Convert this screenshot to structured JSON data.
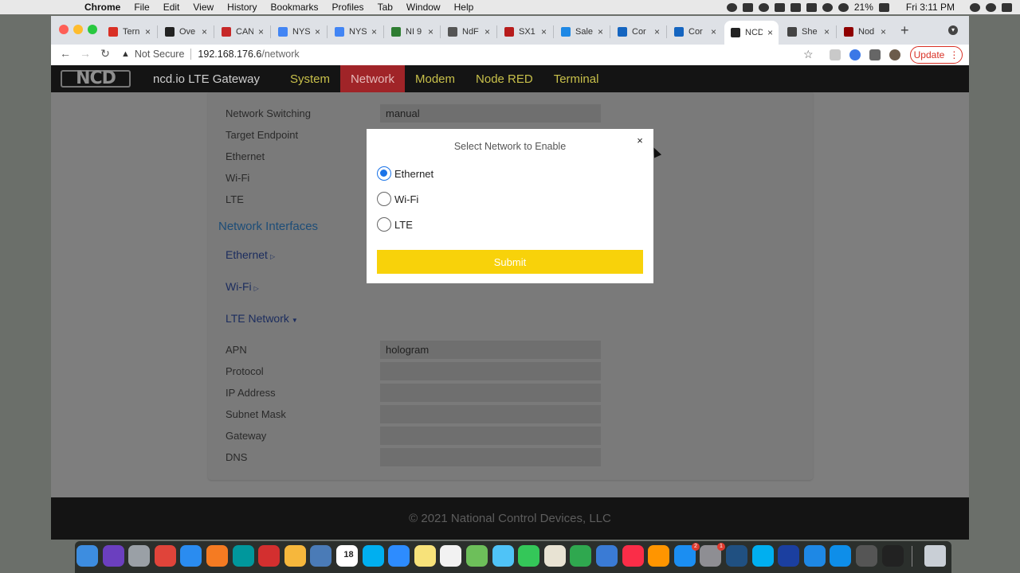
{
  "menubar": {
    "app": "Chrome",
    "items": [
      "File",
      "Edit",
      "View",
      "History",
      "Bookmarks",
      "Profiles",
      "Tab",
      "Window",
      "Help"
    ],
    "battery": "21%",
    "clock": "Fri 3:11 PM"
  },
  "tabs": [
    {
      "label": "Tern",
      "favicon": "gmail-icon",
      "color": "#d93025"
    },
    {
      "label": "Ove",
      "favicon": "link-icon",
      "color": "#222222"
    },
    {
      "label": "CAN",
      "favicon": "g-icon",
      "color": "#c62828"
    },
    {
      "label": "NYS",
      "favicon": "google-icon",
      "color": "#4285f4"
    },
    {
      "label": "NYS",
      "favicon": "google-icon",
      "color": "#4285f4"
    },
    {
      "label": "NI 9",
      "favicon": "ni-icon",
      "color": "#2e7d32"
    },
    {
      "label": "NdF",
      "favicon": "globe-icon",
      "color": "#555555"
    },
    {
      "label": "SX1",
      "favicon": "s-icon",
      "color": "#b71c1c"
    },
    {
      "label": "Sale",
      "favicon": "cloud-icon",
      "color": "#1e88e5"
    },
    {
      "label": "Cor",
      "favicon": "bing-icon",
      "color": "#1565c0"
    },
    {
      "label": "Cor",
      "favicon": "bing-icon",
      "color": "#1565c0"
    },
    {
      "label": "NCD",
      "favicon": "link-icon",
      "color": "#222222",
      "active": true
    },
    {
      "label": "She",
      "favicon": "doc-icon",
      "color": "#444444"
    },
    {
      "label": "Nod",
      "favicon": "node-red-icon",
      "color": "#8f0000"
    }
  ],
  "toolbar": {
    "security": "Not Secure",
    "host": "192.168.176.6",
    "path": "/network",
    "update_label": "Update"
  },
  "site": {
    "logo": "NCD",
    "title": "ncd.io LTE Gateway",
    "nav": [
      {
        "label": "System",
        "active": false
      },
      {
        "label": "Network",
        "active": true
      },
      {
        "label": "Modem",
        "active": false
      },
      {
        "label": "Node RED",
        "active": false
      },
      {
        "label": "Terminal",
        "active": false
      }
    ],
    "footer": "© 2021 National Control Devices, LLC"
  },
  "settings": {
    "network_switching": {
      "label": "Network Switching",
      "value": "manual"
    },
    "target_endpoint": "Target Endpoint",
    "ethernet": "Ethernet",
    "wifi": "Wi-Fi",
    "lte": "LTE"
  },
  "interfaces": {
    "title": "Network Interfaces",
    "ethernet": "Ethernet",
    "wifi": "Wi-Fi",
    "lte": "LTE Network"
  },
  "lte_fields": [
    {
      "label": "APN",
      "value": "hologram"
    },
    {
      "label": "Protocol",
      "value": ""
    },
    {
      "label": "IP Address",
      "value": ""
    },
    {
      "label": "Subnet Mask",
      "value": ""
    },
    {
      "label": "Gateway",
      "value": ""
    },
    {
      "label": "DNS",
      "value": ""
    }
  ],
  "modal": {
    "title": "Select Network to Enable",
    "close": "×",
    "options": [
      {
        "label": "Ethernet",
        "checked": true
      },
      {
        "label": "Wi-Fi",
        "checked": false
      },
      {
        "label": "LTE",
        "checked": false
      }
    ],
    "submit": "Submit"
  },
  "dock": {
    "calendar_day": "18",
    "badges": [
      "2",
      "1"
    ],
    "apps": [
      {
        "name": "finder-icon",
        "color": "#3d8de0"
      },
      {
        "name": "siri-icon",
        "color": "#6b3fbf"
      },
      {
        "name": "launchpad-icon",
        "color": "#9aa0a6"
      },
      {
        "name": "chrome-icon",
        "color": "#e0443a"
      },
      {
        "name": "safari-icon",
        "color": "#2a8cf0"
      },
      {
        "name": "firefox-icon",
        "color": "#f57b22"
      },
      {
        "name": "arduino-icon",
        "color": "#00979c"
      },
      {
        "name": "feather-icon",
        "color": "#d32f2f"
      },
      {
        "name": "photos-icon",
        "color": "#f6b73c"
      },
      {
        "name": "preview-icon",
        "color": "#4a7bb7"
      },
      {
        "name": "calendar-icon",
        "color": "#ffffff"
      },
      {
        "name": "skype-icon",
        "color": "#00aff0"
      },
      {
        "name": "zoom-icon",
        "color": "#2d8cff"
      },
      {
        "name": "notes-icon",
        "color": "#f7e27a"
      },
      {
        "name": "reminders-icon",
        "color": "#f2f2f2"
      },
      {
        "name": "maps-icon",
        "color": "#6dbf5a"
      },
      {
        "name": "messages-icon",
        "color": "#4fc3f7"
      },
      {
        "name": "facetime-icon",
        "color": "#34c759"
      },
      {
        "name": "textedit-icon",
        "color": "#e8e3d3"
      },
      {
        "name": "numbers-icon",
        "color": "#2fa84f"
      },
      {
        "name": "keynote-icon",
        "color": "#3a7bd5"
      },
      {
        "name": "music-icon",
        "color": "#fa2d48"
      },
      {
        "name": "books-icon",
        "color": "#ff9500"
      },
      {
        "name": "app-store-icon",
        "color": "#1b8ef2"
      },
      {
        "name": "system-preferences-icon",
        "color": "#8e8e93"
      },
      {
        "name": "sourcetree-icon",
        "color": "#205081"
      },
      {
        "name": "skype-icon-2",
        "color": "#00aff0"
      },
      {
        "name": "jlink-icon",
        "color": "#1b3fa0"
      },
      {
        "name": "ide-icon",
        "color": "#1e88e5"
      },
      {
        "name": "teamviewer-icon",
        "color": "#0e8ee9"
      },
      {
        "name": "quicktime-icon",
        "color": "#555555"
      },
      {
        "name": "terminal-icon",
        "color": "#222222"
      }
    ]
  }
}
